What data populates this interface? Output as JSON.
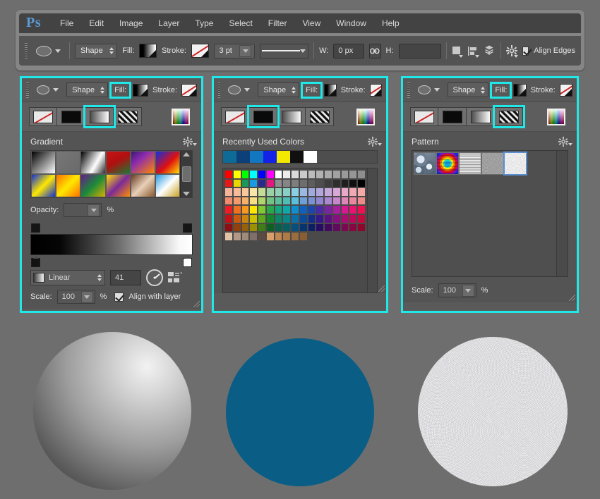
{
  "app": {
    "logo": "Ps",
    "menus": [
      "File",
      "Edit",
      "Image",
      "Layer",
      "Type",
      "Select",
      "Filter",
      "View",
      "Window",
      "Help"
    ]
  },
  "options_bar": {
    "shape_mode": "Shape",
    "fill_label": "Fill:",
    "stroke_label": "Stroke:",
    "stroke_width": "3 pt",
    "w_label": "W:",
    "w_value": "0 px",
    "h_label": "H:",
    "h_value": "",
    "align_edges_label": "Align Edges",
    "align_edges_checked": true,
    "icons": {
      "tool_preset": "ellipse-tool-icon",
      "link": "link-icon",
      "path_operations": "path-operations-icon",
      "path_alignment": "path-alignment-icon",
      "path_arrangement": "path-arrangement-icon",
      "settings": "gear-icon"
    }
  },
  "fill_modes": [
    "no-color",
    "solid-color",
    "gradient",
    "pattern"
  ],
  "highlight_color": "#20e8e8",
  "panels": [
    {
      "id": "gradient",
      "selected_mode_index": 2,
      "shape_mode": "Shape",
      "fill_label": "Fill:",
      "stroke_label": "Stroke:",
      "section_title": "Gradient",
      "opacity_label": "Opacity:",
      "opacity_value": "",
      "percent_label": "%",
      "gradient_type": "Linear",
      "angle_value": "41",
      "scale_label": "Scale:",
      "scale_value": "100",
      "align_with_layer_label": "Align with layer",
      "align_with_layer_checked": true,
      "presets": [
        "linear-gradient(135deg,#000000 0%,#ffffff 100%)",
        "linear-gradient(135deg,#777777 0%,rgba(255,255,255,0) 100%)",
        "linear-gradient(120deg,#000000 0%,#ffffff 60%,#2a2a2a 100%)",
        "linear-gradient(150deg,#c81414 0%,#b01010 45%,#1a7a34 100%)",
        "linear-gradient(140deg,#3a1a6e 0%,#8c2ab0 35%,#ff8a00 100%)",
        "linear-gradient(135deg,#1030e0 0%,#e01010 55%,#ffe000 100%)",
        "linear-gradient(135deg,#1030d8 0%,#ffe800 50%,#1030d8 100%)",
        "linear-gradient(135deg,#ff7000 0%,#ffe800 50%,#ff7000 100%)",
        "linear-gradient(135deg,#6a1a8a 0%,#1a8a3a 50%,#d8b000 100%)",
        "linear-gradient(135deg,#ffe000 0%,#7a2a9a 50%,#ff9000 100%)",
        "linear-gradient(135deg,#6a3a20 0%,#e8d0b8 50%,#8a5a30 100%)",
        "linear-gradient(135deg,#2a9ae0 0%,#ffffff 50%,#c8a020 100%)"
      ]
    },
    {
      "id": "solid",
      "selected_mode_index": 1,
      "shape_mode": "Shape",
      "fill_label": "Fill:",
      "stroke_label": "Stroke:",
      "section_title": "Recently Used Colors",
      "recent_colors": [
        "#0e6a96",
        "#0d3f78",
        "#1277c0",
        "#1422e8",
        "#f2e800",
        "#101010",
        "#ffffff"
      ],
      "swatch_rows": [
        [
          "#ff0000",
          "#ffff00",
          "#00ff00",
          "#00ffff",
          "#0000ff",
          "#ff00ff",
          "#ffffff",
          "#ececec",
          "#dadada",
          "#cacaca",
          "#bcbcbc",
          "#b2b2b2",
          "#aaaaaa",
          "#a2a2a2",
          "#9a9a9a",
          "#969696",
          "#8e8e8e"
        ],
        [
          "#e81818",
          "#e8d800",
          "#189a58",
          "#1a9ae0",
          "#2a2a8a",
          "#e01880",
          "#8e8e8e",
          "#868686",
          "#7e7e7e",
          "#6e6e6e",
          "#5e5e5e",
          "#4e4e4e",
          "#3e3e3e",
          "#2e2e2e",
          "#1e1e1e",
          "#101010",
          "#000000"
        ],
        [
          "#f5b39a",
          "#f7bb9a",
          "#f8c89a",
          "#f8e6a8",
          "#c4dd96",
          "#9ad0a6",
          "#8fd0b6",
          "#88cfc6",
          "#8ad0e2",
          "#9ab8e2",
          "#a0aadd",
          "#b2a6dc",
          "#c4a8dc",
          "#d8a8d8",
          "#e8a8c8",
          "#f0a8b4",
          "#f4a8a8"
        ],
        [
          "#f08a6a",
          "#f59a6a",
          "#f7b06a",
          "#f8de82",
          "#b0d46a",
          "#72c382",
          "#5cc09c",
          "#4dbfb2",
          "#58c0dc",
          "#6f9fd8",
          "#7a92d4",
          "#9286d2",
          "#ab86d2",
          "#c886cc",
          "#de86b8",
          "#ea869e",
          "#ef8a8a"
        ],
        [
          "#ee1c22",
          "#f07020",
          "#f79820",
          "#ffe800",
          "#7ec832",
          "#27a84a",
          "#14a882",
          "#10a8a8",
          "#0e8fd0",
          "#1060c0",
          "#1a46b0",
          "#4a2aa8",
          "#7a24a4",
          "#a820a0",
          "#d81890",
          "#e81470",
          "#ee1050"
        ],
        [
          "#c01218",
          "#c85a10",
          "#cc8410",
          "#cfc200",
          "#5ea820",
          "#14862e",
          "#0c8666",
          "#0a8686",
          "#0a70aa",
          "#0a4a9a",
          "#122c8c",
          "#36188a",
          "#5c1282",
          "#861080",
          "#aa0c70",
          "#bc0a58",
          "#c20a3c"
        ],
        [
          "#8e0e12",
          "#94400c",
          "#96600c",
          "#9a9000",
          "#3e7e14",
          "#0c6020",
          "#08604a",
          "#066060",
          "#065080",
          "#063470",
          "#0c1e66",
          "#260c64",
          "#420a5e",
          "#620a5e",
          "#7c0850",
          "#8a0640",
          "#8e062c"
        ],
        [
          "#e0c4a8",
          "#b29886",
          "#a08a78",
          "#7e7068",
          "#5a4a42",
          "#d8a068",
          "#c08850",
          "#ae7a46",
          "#9a6c3e",
          "#8a5e34"
        ]
      ]
    },
    {
      "id": "pattern",
      "selected_mode_index": 3,
      "shape_mode": "Shape",
      "fill_label": "Fill:",
      "stroke_label": "Stroke:",
      "section_title": "Pattern",
      "scale_label": "Scale:",
      "scale_value": "100",
      "percent_label": "%",
      "selected_pattern_index": 4,
      "patterns": [
        "bubbles",
        "rainbow-optical",
        "fine-lines",
        "gray-grain",
        "white-grain"
      ]
    }
  ],
  "artwork": {
    "circles": [
      {
        "name": "gradient-filled-circle",
        "fill": "gradient"
      },
      {
        "name": "solid-filled-circle",
        "fill": "#0a5e86"
      },
      {
        "name": "pattern-filled-circle",
        "fill": "white-grain-pattern"
      }
    ]
  }
}
